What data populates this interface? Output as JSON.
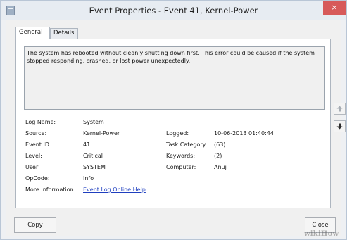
{
  "window": {
    "title": "Event Properties - Event 41, Kernel-Power",
    "close_glyph": "×"
  },
  "tabs": [
    {
      "label": "General",
      "selected": true
    },
    {
      "label": "Details",
      "selected": false
    }
  ],
  "description": "The system has rebooted without cleanly shutting down first. This error could be caused if the system stopped responding, crashed, or lost power unexpectedly.",
  "fields": {
    "log_name": {
      "label": "Log Name:",
      "value": "System"
    },
    "source": {
      "label": "Source:",
      "value": "Kernel-Power"
    },
    "logged": {
      "label": "Logged:",
      "value": "10-06-2013 01:40:44"
    },
    "event_id": {
      "label": "Event ID:",
      "value": "41"
    },
    "task_category": {
      "label": "Task Category:",
      "value": "(63)"
    },
    "level": {
      "label": "Level:",
      "value": "Critical"
    },
    "keywords": {
      "label": "Keywords:",
      "value": "(2)"
    },
    "user": {
      "label": "User:",
      "value": "SYSTEM"
    },
    "computer": {
      "label": "Computer:",
      "value": "Anuj"
    },
    "opcode": {
      "label": "OpCode:",
      "value": "Info"
    },
    "more_info": {
      "label": "More Information:",
      "link": "Event Log Online Help"
    }
  },
  "buttons": {
    "copy": "Copy",
    "close": "Close"
  },
  "side_buttons": {
    "up_icon": "up-arrow-icon",
    "down_icon": "down-arrow-icon"
  },
  "watermark": "wikiHow",
  "colors": {
    "close_button": "#d75a5a",
    "link": "#1f3fbf",
    "titlebar": "#e7ecf2"
  }
}
